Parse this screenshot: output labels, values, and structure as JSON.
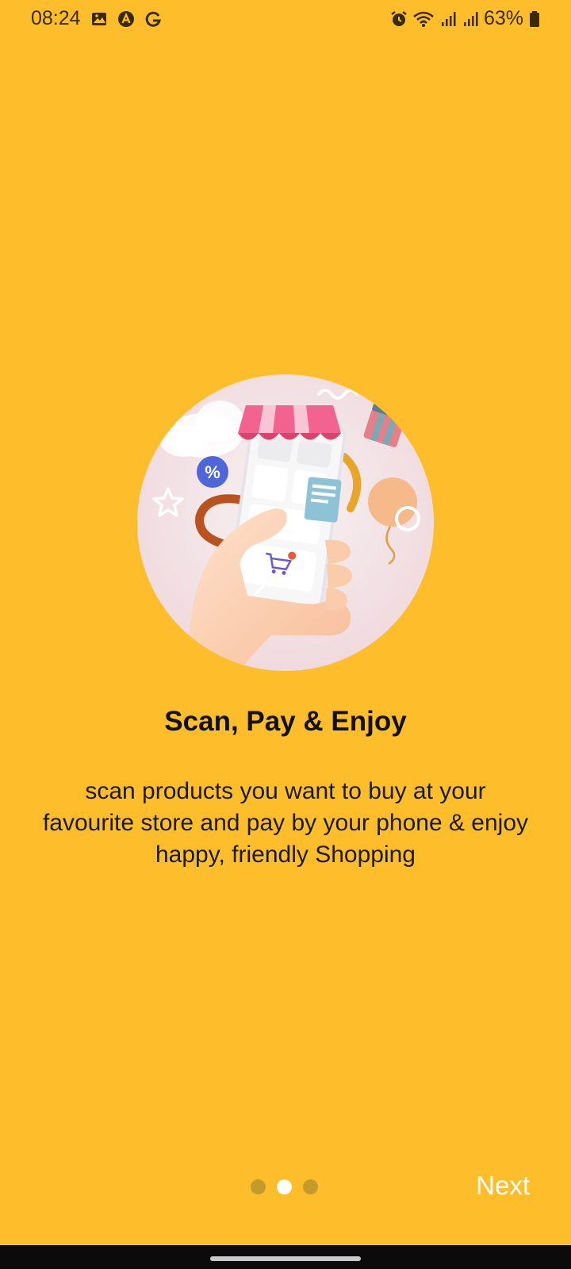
{
  "status_bar": {
    "time": "08:24",
    "battery_percent": "63%",
    "left_icons": [
      "image-icon",
      "a-circle-icon",
      "google-g-icon"
    ],
    "right_icons": [
      "alarm-icon",
      "wifi-icon",
      "signal-icon",
      "signal-icon",
      "battery-icon"
    ]
  },
  "onboarding": {
    "illustration_icon": "shopping-phone-illustration",
    "title": "Scan, Pay & Enjoy",
    "description": "scan products you want to buy at your favourite store and pay by your phone & enjoy happy, friendly Shopping",
    "page_count": 3,
    "active_page": 2,
    "next_label": "Next"
  },
  "colors": {
    "background": "#FEBD2B",
    "dot_inactive": "#C49A2C",
    "dot_active": "#FFFFFF",
    "next_text": "#FFFFFF"
  }
}
